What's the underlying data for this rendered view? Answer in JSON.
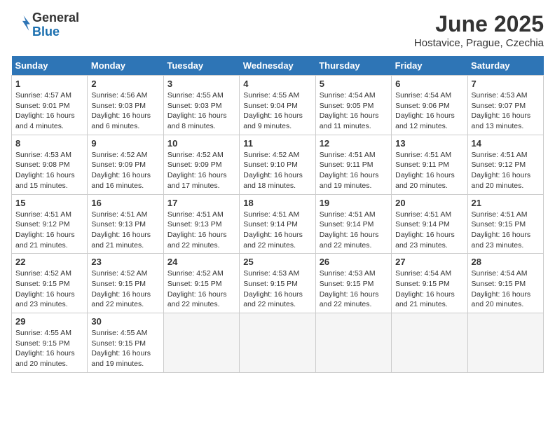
{
  "header": {
    "logo_text_general": "General",
    "logo_text_blue": "Blue",
    "month": "June 2025",
    "location": "Hostavice, Prague, Czechia"
  },
  "weekdays": [
    "Sunday",
    "Monday",
    "Tuesday",
    "Wednesday",
    "Thursday",
    "Friday",
    "Saturday"
  ],
  "weeks": [
    [
      {
        "day": "1",
        "sunrise": "4:57 AM",
        "sunset": "9:01 PM",
        "daylight": "16 hours and 4 minutes."
      },
      {
        "day": "2",
        "sunrise": "4:56 AM",
        "sunset": "9:03 PM",
        "daylight": "16 hours and 6 minutes."
      },
      {
        "day": "3",
        "sunrise": "4:55 AM",
        "sunset": "9:03 PM",
        "daylight": "16 hours and 8 minutes."
      },
      {
        "day": "4",
        "sunrise": "4:55 AM",
        "sunset": "9:04 PM",
        "daylight": "16 hours and 9 minutes."
      },
      {
        "day": "5",
        "sunrise": "4:54 AM",
        "sunset": "9:05 PM",
        "daylight": "16 hours and 11 minutes."
      },
      {
        "day": "6",
        "sunrise": "4:54 AM",
        "sunset": "9:06 PM",
        "daylight": "16 hours and 12 minutes."
      },
      {
        "day": "7",
        "sunrise": "4:53 AM",
        "sunset": "9:07 PM",
        "daylight": "16 hours and 13 minutes."
      }
    ],
    [
      {
        "day": "8",
        "sunrise": "4:53 AM",
        "sunset": "9:08 PM",
        "daylight": "16 hours and 15 minutes."
      },
      {
        "day": "9",
        "sunrise": "4:52 AM",
        "sunset": "9:09 PM",
        "daylight": "16 hours and 16 minutes."
      },
      {
        "day": "10",
        "sunrise": "4:52 AM",
        "sunset": "9:09 PM",
        "daylight": "16 hours and 17 minutes."
      },
      {
        "day": "11",
        "sunrise": "4:52 AM",
        "sunset": "9:10 PM",
        "daylight": "16 hours and 18 minutes."
      },
      {
        "day": "12",
        "sunrise": "4:51 AM",
        "sunset": "9:11 PM",
        "daylight": "16 hours and 19 minutes."
      },
      {
        "day": "13",
        "sunrise": "4:51 AM",
        "sunset": "9:11 PM",
        "daylight": "16 hours and 20 minutes."
      },
      {
        "day": "14",
        "sunrise": "4:51 AM",
        "sunset": "9:12 PM",
        "daylight": "16 hours and 20 minutes."
      }
    ],
    [
      {
        "day": "15",
        "sunrise": "4:51 AM",
        "sunset": "9:12 PM",
        "daylight": "16 hours and 21 minutes."
      },
      {
        "day": "16",
        "sunrise": "4:51 AM",
        "sunset": "9:13 PM",
        "daylight": "16 hours and 21 minutes."
      },
      {
        "day": "17",
        "sunrise": "4:51 AM",
        "sunset": "9:13 PM",
        "daylight": "16 hours and 22 minutes."
      },
      {
        "day": "18",
        "sunrise": "4:51 AM",
        "sunset": "9:14 PM",
        "daylight": "16 hours and 22 minutes."
      },
      {
        "day": "19",
        "sunrise": "4:51 AM",
        "sunset": "9:14 PM",
        "daylight": "16 hours and 22 minutes."
      },
      {
        "day": "20",
        "sunrise": "4:51 AM",
        "sunset": "9:14 PM",
        "daylight": "16 hours and 23 minutes."
      },
      {
        "day": "21",
        "sunrise": "4:51 AM",
        "sunset": "9:15 PM",
        "daylight": "16 hours and 23 minutes."
      }
    ],
    [
      {
        "day": "22",
        "sunrise": "4:52 AM",
        "sunset": "9:15 PM",
        "daylight": "16 hours and 23 minutes."
      },
      {
        "day": "23",
        "sunrise": "4:52 AM",
        "sunset": "9:15 PM",
        "daylight": "16 hours and 22 minutes."
      },
      {
        "day": "24",
        "sunrise": "4:52 AM",
        "sunset": "9:15 PM",
        "daylight": "16 hours and 22 minutes."
      },
      {
        "day": "25",
        "sunrise": "4:53 AM",
        "sunset": "9:15 PM",
        "daylight": "16 hours and 22 minutes."
      },
      {
        "day": "26",
        "sunrise": "4:53 AM",
        "sunset": "9:15 PM",
        "daylight": "16 hours and 22 minutes."
      },
      {
        "day": "27",
        "sunrise": "4:54 AM",
        "sunset": "9:15 PM",
        "daylight": "16 hours and 21 minutes."
      },
      {
        "day": "28",
        "sunrise": "4:54 AM",
        "sunset": "9:15 PM",
        "daylight": "16 hours and 20 minutes."
      }
    ],
    [
      {
        "day": "29",
        "sunrise": "4:55 AM",
        "sunset": "9:15 PM",
        "daylight": "16 hours and 20 minutes."
      },
      {
        "day": "30",
        "sunrise": "4:55 AM",
        "sunset": "9:15 PM",
        "daylight": "16 hours and 19 minutes."
      },
      null,
      null,
      null,
      null,
      null
    ]
  ]
}
